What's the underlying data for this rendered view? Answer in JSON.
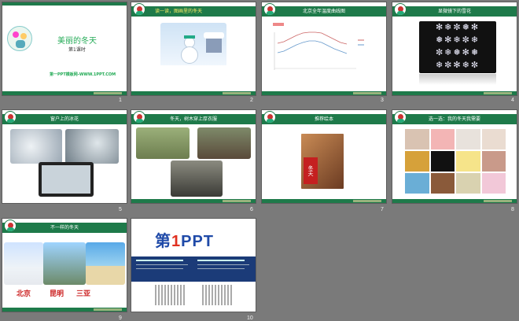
{
  "slides": [
    {
      "number": "1",
      "title": "美丽的冬天",
      "subtitle": "第1课时",
      "footer_text": "第一PPT模板网-WWW.1PPT.COM"
    },
    {
      "number": "2",
      "title": "读一读，图画里的冬天"
    },
    {
      "number": "3",
      "title": "北京全年温度曲线图",
      "chart_title": "北京全年温度曲线图"
    },
    {
      "number": "4",
      "title": "显微镜下的雪花"
    },
    {
      "number": "5",
      "title": "窗户上的冰花"
    },
    {
      "number": "6",
      "title": "冬天，树木穿上厚衣服"
    },
    {
      "number": "7",
      "title": "推荐绘本",
      "book_title": "冬天"
    },
    {
      "number": "8",
      "title": "选一选：我的冬天我需要"
    },
    {
      "number": "9",
      "title": "不一样的冬天",
      "captions": [
        "北京",
        "昆明",
        "三亚"
      ]
    },
    {
      "number": "10",
      "brand_prefix": "第",
      "brand_number": "1",
      "brand_suffix": "PPT"
    }
  ],
  "colors": {
    "green": "#1e7a4a",
    "background": "#7a7a7a"
  }
}
